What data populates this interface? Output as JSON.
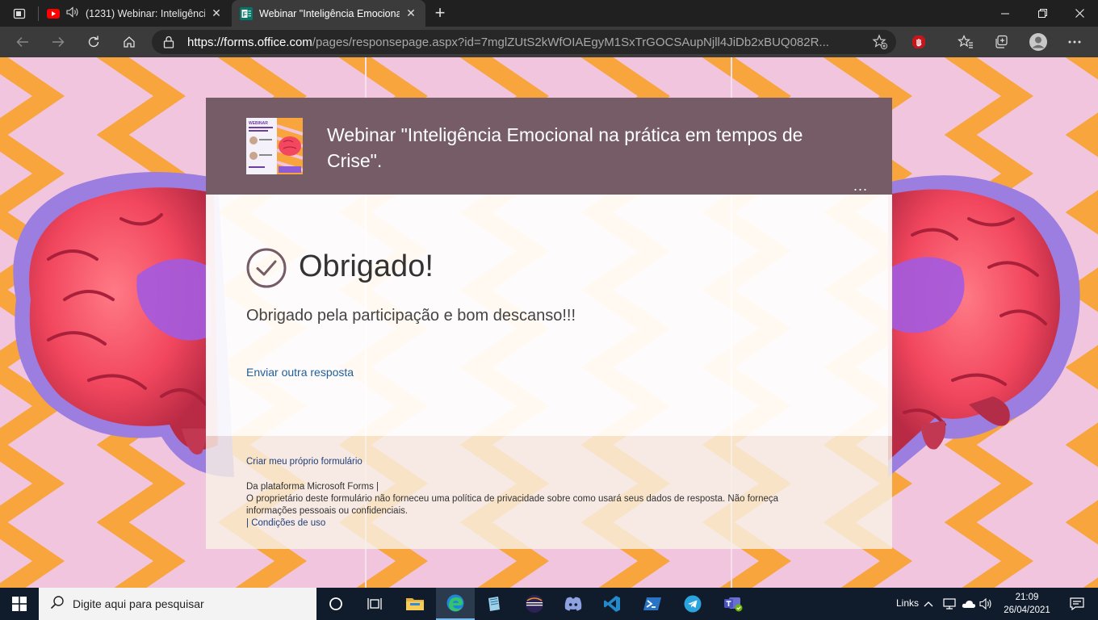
{
  "browser": {
    "tabs": [
      {
        "title": "(1231) Webinar: Inteligência",
        "favicon": "youtube-icon",
        "audio": true
      },
      {
        "title": "Webinar \"Inteligência Emocional",
        "favicon": "forms-icon",
        "active": true
      }
    ],
    "url": {
      "scheme": "https://",
      "host": "forms.office.com",
      "path": "/pages/responsepage.aspx?id=7mglZUtS2kWfOIAEgyM1SxTrGOCSAupNjll4JiDb2xBUQ082R..."
    }
  },
  "form": {
    "header_title": "Webinar \"Inteligência Emocional na prática em tempos de Crise\".",
    "more_label": "...",
    "thumbnail_label": "WEBINAR",
    "thanks_title": "Obrigado!",
    "thanks_message": "Obrigado pela participação e bom descanso!!!",
    "submit_another": "Enviar outra resposta"
  },
  "footer": {
    "create_link": "Criar meu próprio formulário",
    "platform": "Da plataforma Microsoft Forms |",
    "privacy_note": "O proprietário deste formulário não forneceu uma política de privacidade sobre como usará seus dados de resposta. Não forneça informações pessoais ou confidenciais.",
    "terms_sep": "| ",
    "terms_link": "Condições de uso"
  },
  "taskbar": {
    "search_placeholder": "Digite aqui para pesquisar",
    "links_label": "Links",
    "time": "21:09",
    "date": "26/04/2021",
    "apps": [
      "task-view-icon",
      "file-explorer-icon",
      "edge-icon",
      "notes-app-icon",
      "eclipse-icon",
      "discord-icon",
      "vscode-icon",
      "powershell-icon",
      "telegram-icon",
      "teams-icon"
    ]
  },
  "colors": {
    "header_bg": "#755c67",
    "link": "#1f5f99",
    "bg_orange": "#f7a53c",
    "bg_pink": "#f2c5de"
  }
}
